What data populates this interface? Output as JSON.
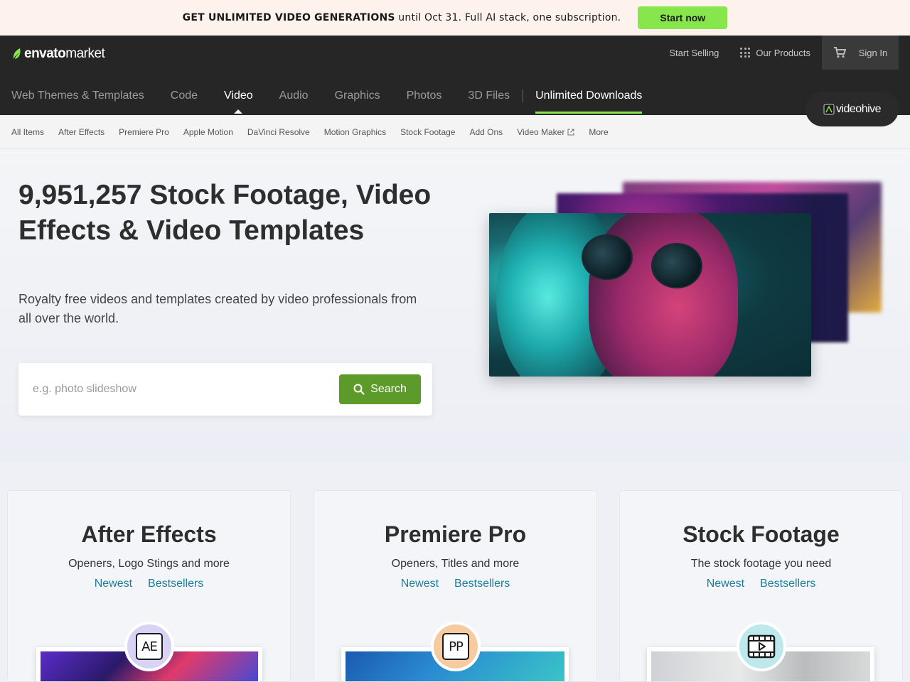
{
  "promo": {
    "bold": "GET UNLIMITED VIDEO GENERATIONS",
    "text": " until Oct 31. Full AI stack, one subscription.",
    "button": "Start now"
  },
  "header": {
    "logo_bold": "envato",
    "logo_light": "market",
    "start_selling": "Start Selling",
    "our_products": "Our Products",
    "sign_in": "Sign In",
    "nav": [
      "Web Themes & Templates",
      "Code",
      "Video",
      "Audio",
      "Graphics",
      "Photos",
      "3D Files"
    ],
    "unlimited": "Unlimited Downloads",
    "site_badge": "videohive"
  },
  "subnav": [
    "All Items",
    "After Effects",
    "Premiere Pro",
    "Apple Motion",
    "DaVinci Resolve",
    "Motion Graphics",
    "Stock Footage",
    "Add Ons",
    "Video Maker",
    "More"
  ],
  "hero": {
    "title": "9,951,257 Stock Footage, Video Effects & Video Templates",
    "subtitle": "Royalty free videos and templates created by video professionals from all over the world.",
    "search_placeholder": "e.g. photo slideshow",
    "search_button": "Search"
  },
  "cards": [
    {
      "title": "After Effects",
      "subtitle": "Openers, Logo Stings and more",
      "newest": "Newest",
      "bestsellers": "Bestsellers",
      "badge": "AE",
      "badge_color": "#d8d3f5"
    },
    {
      "title": "Premiere Pro",
      "subtitle": "Openers, Titles and more",
      "newest": "Newest",
      "bestsellers": "Bestsellers",
      "badge": "PP",
      "badge_color": "#f7cba0"
    },
    {
      "title": "Stock Footage",
      "subtitle": "The stock footage you need",
      "newest": "Newest",
      "bestsellers": "Bestsellers",
      "badge_icon": "film-play-icon",
      "badge_color": "#bde8ec"
    }
  ],
  "colors": {
    "accent_green": "#87e64b",
    "search_green": "#5c9a2a",
    "link_blue": "#1a7e9e",
    "header_bg": "#262626"
  }
}
